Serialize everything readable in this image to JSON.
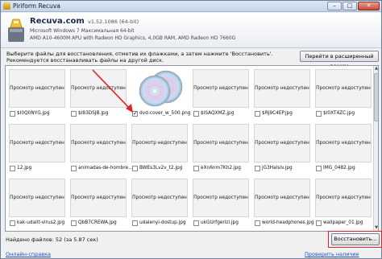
{
  "window": {
    "title": "Piriform Recuva",
    "min": "–",
    "max": "□",
    "close": "✕"
  },
  "header": {
    "app_name": "Recuva",
    "app_domain": ".com",
    "version": "v1.52.1086 (64-bit)",
    "sys_line1": "Microsoft Windows 7 Максимальная 64-bit",
    "sys_line2": "AMD A10-4600M APU with Radeon HD Graphics, 4,0GB RAM, AMD Radeon HD 7660G"
  },
  "instructions": {
    "line1": "Выберите файлы для восстановления, отметив их флажками, а затем нажмите 'Восстановить'.",
    "line2": "Рекомендуется восстанавливать файлы на другой диск."
  },
  "advanced_button": "Перейти в расширенный режим",
  "thumb_unavailable": "Просмотр недоступен",
  "files": [
    {
      "name": "$I0Q0NYG.jpg",
      "checked": false,
      "preview": false
    },
    {
      "name": "$I83DSJB.jpg",
      "checked": false,
      "preview": false
    },
    {
      "name": "dvd-cover_w_500.png",
      "checked": true,
      "preview": true
    },
    {
      "name": "$ISAQXMZ.jpg",
      "checked": false,
      "preview": false
    },
    {
      "name": "$RJ9C4EP.jpg",
      "checked": false,
      "preview": false
    },
    {
      "name": "$I0XT4ZC.jpg",
      "checked": false,
      "preview": false
    },
    {
      "name": "12.jpg",
      "checked": false,
      "preview": false
    },
    {
      "name": "animadas-de-hombre...",
      "checked": false,
      "preview": false
    },
    {
      "name": "BWEs3Lv2v_t2.jpg",
      "checked": false,
      "preview": false
    },
    {
      "name": "eXn6nm7Kh2.jpg",
      "checked": false,
      "preview": false
    },
    {
      "name": "jG3Halslv.jpg",
      "checked": false,
      "preview": false
    },
    {
      "name": "IMG_0482.jpg",
      "checked": false,
      "preview": false
    },
    {
      "name": "kak-udalit-virus2.jpg",
      "checked": false,
      "preview": false
    },
    {
      "name": "QbB7CREWA.jpg",
      "checked": false,
      "preview": false
    },
    {
      "name": "udalenyi-dostup.jpg",
      "checked": false,
      "preview": false
    },
    {
      "name": "ukGUrfgerlzl.jpg",
      "checked": false,
      "preview": false
    },
    {
      "name": "world-headphones.jpg",
      "checked": false,
      "preview": false
    },
    {
      "name": "wallpaper_01.jpg",
      "checked": false,
      "preview": false
    }
  ],
  "status": "Найдено файлов: 52 (за 5.87 сек)",
  "restore_button": "Восстановить...",
  "help_link": "Онлайн-справка",
  "update_link": "Проверить наличие обновлений...",
  "colors": {
    "highlight": "#d9242a",
    "arrow": "#d9242a",
    "link": "#1f4fb8"
  }
}
